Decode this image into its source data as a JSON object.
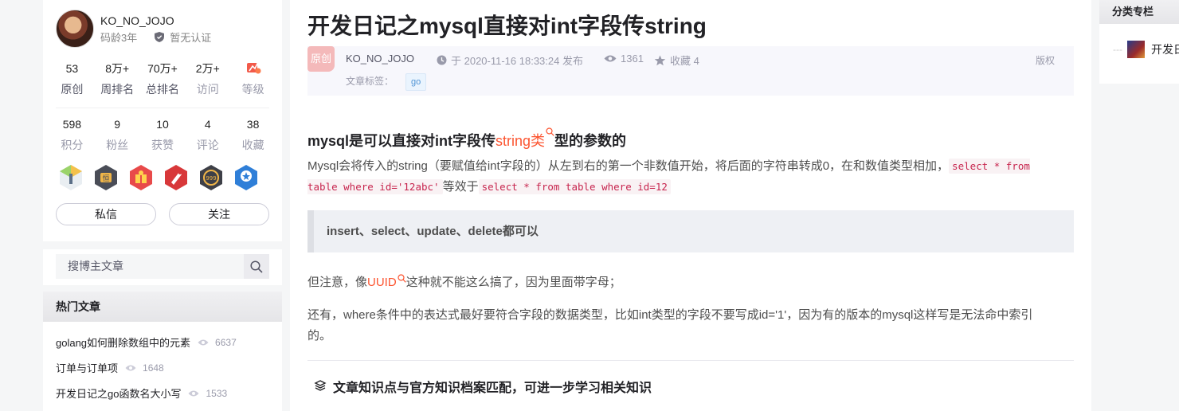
{
  "profile": {
    "username": "KO_NO_JOJO",
    "years": "码龄3年",
    "cert": "暂无认证",
    "stats_row1": [
      {
        "num": "53",
        "label": "原创"
      },
      {
        "num": "8万+",
        "label": "周排名"
      },
      {
        "num": "70万+",
        "label": "总排名"
      },
      {
        "num": "2万+",
        "label": "访问"
      },
      {
        "num": "",
        "label": "等级"
      }
    ],
    "stats_row2": [
      {
        "num": "598",
        "label": "积分"
      },
      {
        "num": "9",
        "label": "粉丝"
      },
      {
        "num": "10",
        "label": "获赞"
      },
      {
        "num": "4",
        "label": "评论"
      },
      {
        "num": "38",
        "label": "收藏"
      }
    ],
    "message_button": "私信",
    "follow_button": "关注"
  },
  "search": {
    "placeholder": "搜博主文章"
  },
  "hot": {
    "title": "热门文章",
    "items": [
      {
        "title": "golang如何删除数组中的元素",
        "views": "6637"
      },
      {
        "title": "订单与订单项",
        "views": "1648"
      },
      {
        "title": "开发日记之go函数名大小写",
        "views": "1533"
      }
    ]
  },
  "article": {
    "title": "开发日记之mysql直接对int字段传string",
    "type_badge": "原创",
    "author": "KO_NO_JOJO",
    "published": "于 2020-11-16 18:33:24 发布",
    "views": "1361",
    "favorites": "收藏 4",
    "copyright": "版权",
    "tags_label": "文章标签：",
    "tag": "go",
    "heading_pre": "mysql是可以直接对int字段传",
    "heading_link": "string类",
    "heading_post": "型的参数的",
    "p1_text": "Mysql会将传入的string（要赋值给int字段的）从左到右的第一个非数值开始，将后面的字符串转成0，在和数值类型相加，",
    "p1_code1": "select * from table where id='12abc'",
    "p1_mid": "等效于",
    "p1_code2": "select * from table where id=12",
    "quote": "insert、select、update、delete都可以",
    "p2_pre": "但注意，像",
    "p2_link": "UUID",
    "p2_post": "这种就不能这么搞了，因为里面带字母；",
    "p3": "还有，where条件中的表达式最好要符合字段的数据类型，比如int类型的字段不要写成id='1'，因为有的版本的mysql这样写是无法命中索引的。",
    "knowledge": "文章知识点与官方知识档案匹配，可进一步学习相关知识",
    "cut_line": ""
  },
  "right": {
    "title": "分类专栏",
    "item": "开发日"
  },
  "colors": {
    "accent": "#fc5531",
    "orig_badge": "#f4b9ba",
    "tag_blue": "#5094d5"
  }
}
